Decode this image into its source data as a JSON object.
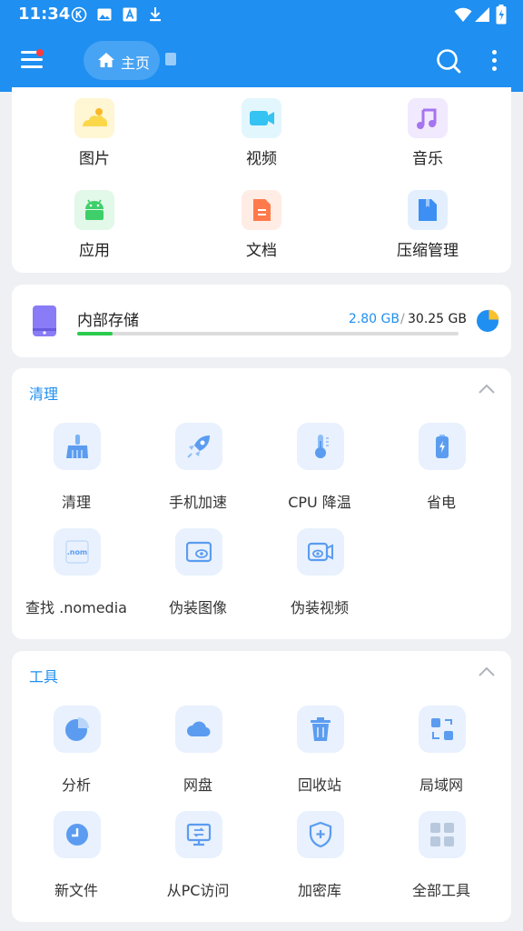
{
  "status": {
    "time": "11:34"
  },
  "header": {
    "home_label": "主页"
  },
  "categories": [
    {
      "label": "图片",
      "icon": "image-icon",
      "color": "#fbd84a",
      "bg": "#fff6d4"
    },
    {
      "label": "视频",
      "icon": "video-icon",
      "color": "#34c3f2",
      "bg": "#e2f6fd"
    },
    {
      "label": "音乐",
      "icon": "music-icon",
      "color": "#a574f0",
      "bg": "#f1e9fd"
    },
    {
      "label": "应用",
      "icon": "android-icon",
      "color": "#3fcf6a",
      "bg": "#e2f8e8"
    },
    {
      "label": "文档",
      "icon": "document-icon",
      "color": "#ff7a4a",
      "bg": "#ffece4"
    },
    {
      "label": "压缩管理",
      "icon": "archive-icon",
      "color": "#3d8ff3",
      "bg": "#e3effd"
    }
  ],
  "storage": {
    "title": "内部存储",
    "used": "2.80 GB",
    "separator": "/",
    "total": "30.25 GB",
    "used_fraction": 0.0926
  },
  "clean": {
    "title": "清理",
    "items": [
      {
        "label": "清理",
        "icon": "broom-icon"
      },
      {
        "label": "手机加速",
        "icon": "rocket-icon"
      },
      {
        "label": "CPU 降温",
        "icon": "thermometer-icon"
      },
      {
        "label": "省电",
        "icon": "battery-icon"
      },
      {
        "label": "查找 .nomedia",
        "icon": "nomedia-icon"
      },
      {
        "label": "伪装图像",
        "icon": "disguise-image-icon"
      },
      {
        "label": "伪装视频",
        "icon": "disguise-video-icon"
      }
    ]
  },
  "tools": {
    "title": "工具",
    "items": [
      {
        "label": "分析",
        "icon": "pie-chart-icon"
      },
      {
        "label": "网盘",
        "icon": "cloud-icon"
      },
      {
        "label": "回收站",
        "icon": "trash-icon"
      },
      {
        "label": "局域网",
        "icon": "lan-icon"
      },
      {
        "label": "新文件",
        "icon": "clock-icon"
      },
      {
        "label": "从PC访问",
        "icon": "pc-access-icon"
      },
      {
        "label": "加密库",
        "icon": "shield-icon"
      },
      {
        "label": "全部工具",
        "icon": "grid-icon"
      }
    ]
  },
  "colors": {
    "accent": "#1f8ff1",
    "progress": "#2bcb4e"
  }
}
